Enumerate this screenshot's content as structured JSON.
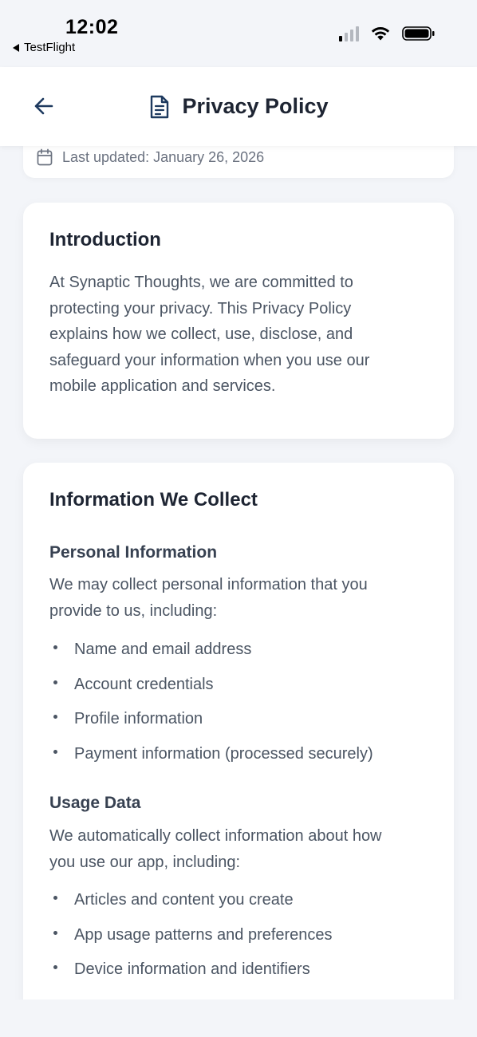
{
  "status_bar": {
    "time": "12:02",
    "back_app": "TestFlight"
  },
  "header": {
    "title": "Privacy Policy",
    "back_icon": "arrow-left-icon",
    "title_icon": "document-icon"
  },
  "last_updated": {
    "icon": "calendar-icon",
    "text": "Last updated: January 26, 2026"
  },
  "introduction": {
    "title": "Introduction",
    "lines": [
      "At Synaptic Thoughts, we are committed to",
      "protecting your privacy. This Privacy Policy",
      "explains how we collect, use, disclose, and",
      "safeguard your information when you use our",
      "mobile application and services."
    ]
  },
  "information_we_collect": {
    "title": "Information We Collect",
    "personal": {
      "title": "Personal Information",
      "lines": [
        "We may collect personal information that you",
        "provide to us, including:"
      ],
      "items": [
        "Name and email address",
        "Account credentials",
        "Profile information",
        "Payment information (processed securely)"
      ]
    },
    "usage": {
      "title": "Usage Data",
      "lines": [
        "We automatically collect information about how",
        "you use our app, including:"
      ],
      "items": [
        "Articles and content you create",
        "App usage patterns and preferences",
        "Device information and identifiers"
      ]
    }
  },
  "colors": {
    "background": "#f3f5f9",
    "card": "#ffffff",
    "title": "#1e2533",
    "body_text": "#4b5563",
    "muted": "#6b7280"
  }
}
